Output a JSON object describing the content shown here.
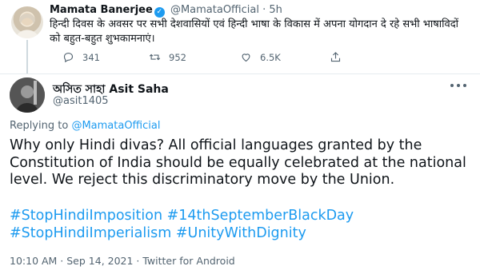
{
  "parent_tweet": {
    "author_name": "Mamata Banerjee",
    "verified_icon": "verified-badge-icon",
    "handle": "@MamataOfficial",
    "separator": "·",
    "time": "5h",
    "text": "हिन्दी दिवस के अवसर पर सभी देशवासियों एवं हिन्दी भाषा के विकास में अपना योगदान दे रहे सभी भाषाविदों को बहुत-बहुत शुभकामनाएं।",
    "actions": {
      "replies": "341",
      "retweets": "952",
      "likes": "6.5K"
    }
  },
  "reply_tweet": {
    "author_name": "অসিত সাহা Asit Saha",
    "handle": "@asit1405",
    "replying_prefix": "Replying to ",
    "replying_to": "@MamataOfficial",
    "text": "Why only Hindi divas? All official languages granted by the Constitution of India should be equally celebrated at the national level. We reject this discriminatory move by the Union.",
    "hashtags_line1": "#StopHindiImposition #14thSeptemberBlackDay",
    "hashtags_line2": "#StopHindiImperialism #UnityWithDignity",
    "meta": "10:10 AM · Sep 14, 2021 · Twitter for Android"
  },
  "colors": {
    "accent": "#1d9bf0",
    "secondary_text": "#536471",
    "primary_text": "#0f1419"
  }
}
